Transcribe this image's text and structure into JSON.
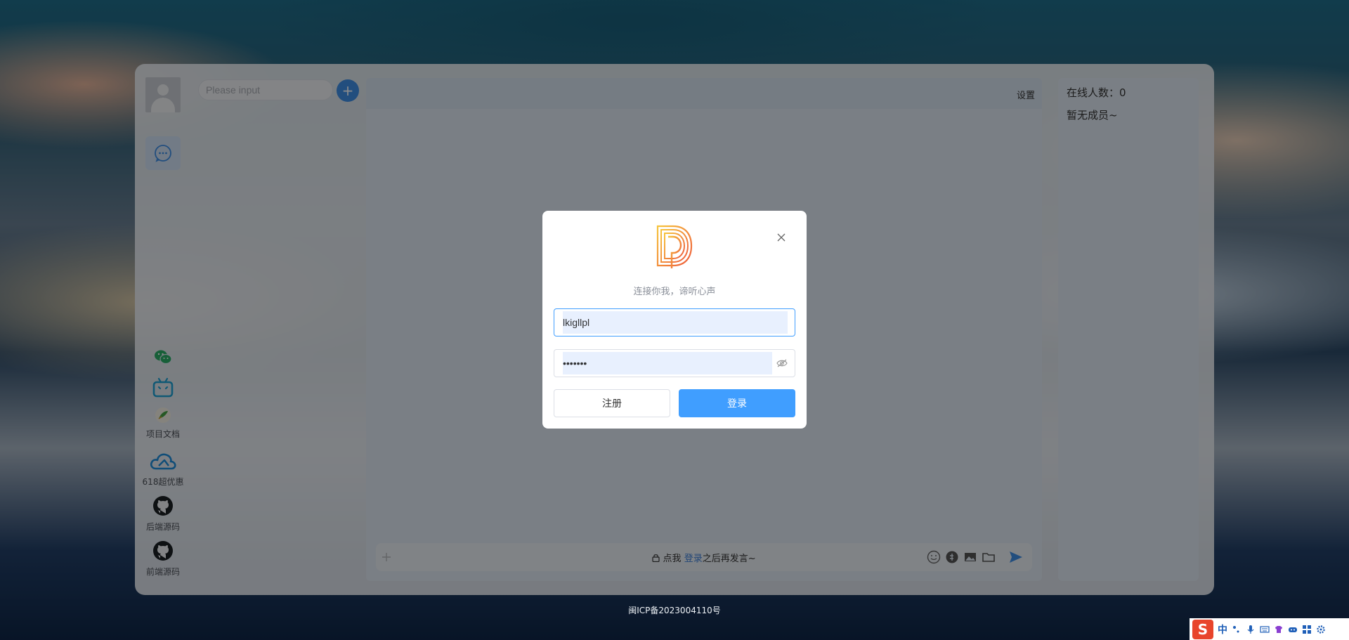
{
  "sidebar": {
    "links": [
      {
        "icon": "wechat-icon",
        "label": ""
      },
      {
        "icon": "bilibili-icon",
        "label": ""
      },
      {
        "icon": "project-doc-icon",
        "label": "项目文档"
      },
      {
        "icon": "cloud-icon",
        "label": "618超优惠"
      },
      {
        "icon": "github-icon",
        "label": "后端源码"
      },
      {
        "icon": "github-icon",
        "label": "前端源码"
      }
    ]
  },
  "search": {
    "placeholder": "Please input"
  },
  "chat": {
    "settings_label": "设置",
    "hint_prefix": "点我",
    "hint_link": "登录",
    "hint_suffix": "之后再发言~"
  },
  "members": {
    "count_label": "在线人数：0",
    "empty_label": "暂无成员~"
  },
  "login_dialog": {
    "slogan": "连接你我，谛听心声",
    "username_value": "lkigllpl",
    "password_value": "•••••••",
    "register_label": "注册",
    "login_label": "登录"
  },
  "footer": {
    "icp": "闽ICP备2023004110号"
  },
  "taskbar": {
    "ime_logo": "S",
    "ime_mode": "中"
  },
  "colors": {
    "primary": "#409eff",
    "accent": "#3f8ee6",
    "overlay": "rgba(0,0,0,0.45)"
  }
}
